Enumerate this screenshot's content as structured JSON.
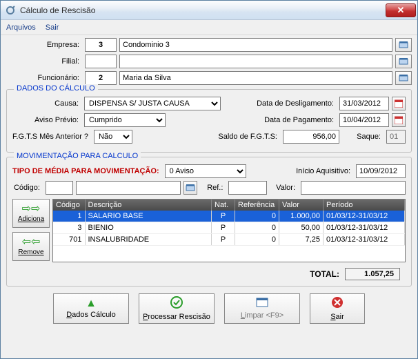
{
  "window": {
    "title": "Cálculo de Rescisão"
  },
  "menu": {
    "arquivos": "Arquivos",
    "sair": "Sair"
  },
  "top": {
    "empresa_label": "Empresa:",
    "empresa_code": "3",
    "empresa_name": "Condominio 3",
    "filial_label": "Filial:",
    "filial_code": "",
    "filial_name": "",
    "func_label": "Funcionário:",
    "func_code": "2",
    "func_name": "Maria da Silva"
  },
  "dados": {
    "legend": "DADOS DO CÁLCULO",
    "causa_label": "Causa:",
    "causa_value": "DISPENSA S/ JUSTA CAUSA",
    "desligamento_label": "Data de Desligamento:",
    "desligamento_value": "31/03/2012",
    "aviso_label": "Aviso Prévio:",
    "aviso_value": "Cumprido",
    "pagamento_label": "Data de Pagamento:",
    "pagamento_value": "10/04/2012",
    "fgts_mes_label": "F.G.T.S Mês Anterior ?",
    "fgts_mes_value": "Não",
    "saldo_label": "Saldo de F.G.T.S:",
    "saldo_value": "956,00",
    "saque_label": "Saque:",
    "saque_value": "01"
  },
  "mov": {
    "legend": "MOVIMENTAÇÃO PARA CALCULO",
    "tipo_label": "TIPO DE MÉDIA PARA MOVIMENTAÇÃO:",
    "tipo_value": "0 Aviso",
    "inicio_label": "Início Aquisitivo:",
    "inicio_value": "10/09/2012",
    "codigo_label": "Código:",
    "codigo_value": "",
    "codigo_desc": "",
    "ref_label": "Ref.:",
    "ref_value": "",
    "valor_label": "Valor:",
    "valor_value": "",
    "table": {
      "headers": {
        "codigo": "Código",
        "descricao": "Descrição",
        "nat": "Nat.",
        "referencia": "Referência",
        "valor": "Valor",
        "periodo": "Período"
      },
      "rows": [
        {
          "codigo": "1",
          "descricao": "SALARIO BASE",
          "nat": "P",
          "referencia": "0",
          "valor": "1.000,00",
          "periodo": "01/03/12-31/03/12",
          "selected": true
        },
        {
          "codigo": "3",
          "descricao": "BIENIO",
          "nat": "P",
          "referencia": "0",
          "valor": "50,00",
          "periodo": "01/03/12-31/03/12",
          "selected": false
        },
        {
          "codigo": "701",
          "descricao": "INSALUBRIDADE",
          "nat": "P",
          "referencia": "0",
          "valor": "7,25",
          "periodo": "01/03/12-31/03/12",
          "selected": false
        }
      ]
    },
    "adiciona_label": "Adiciona",
    "remove_label": "Remove",
    "total_label": "TOTAL:",
    "total_value": "1.057,25"
  },
  "buttons": {
    "dados": "Dados Cálculo",
    "processar": "Processar Rescisão",
    "limpar": "Limpar <F9>",
    "sair": "Sair"
  }
}
